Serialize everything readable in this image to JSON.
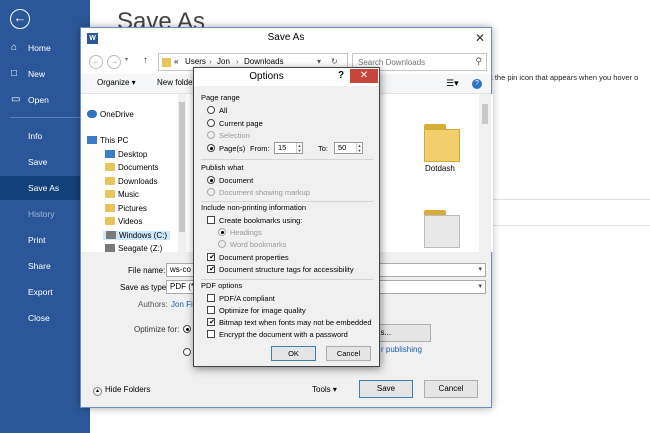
{
  "backstage": {
    "title": "Save As",
    "hint": "k the pin icon that appears when you hover o",
    "nav": [
      {
        "label": "Home",
        "icon": "home-icon"
      },
      {
        "label": "New",
        "icon": "new-document-icon"
      },
      {
        "label": "Open",
        "icon": "open-folder-icon"
      },
      {
        "label": "Info"
      },
      {
        "label": "Save"
      },
      {
        "label": "Save As"
      },
      {
        "label": "History"
      },
      {
        "label": "Print"
      },
      {
        "label": "Share"
      },
      {
        "label": "Export"
      },
      {
        "label": "Close"
      }
    ]
  },
  "save_dialog": {
    "title": "Save As",
    "path": {
      "prefix": "«",
      "parts": [
        "Users",
        "Jon",
        "Downloads"
      ]
    },
    "search_placeholder": "Search Downloads",
    "toolbar": {
      "organize": "Organize ▾",
      "new_folder": "New folder"
    },
    "tree": [
      "OneDrive",
      "This PC",
      "Desktop",
      "Documents",
      "Downloads",
      "Music",
      "Pictures",
      "Videos",
      "Windows (C:)",
      "Seagate (Z:)"
    ],
    "files": [
      {
        "name": "Dotdash"
      }
    ],
    "file_name_label": "File name:",
    "file_name_value": "ws-co",
    "save_type_label": "Save as type:",
    "save_type_value": "PDF (*.",
    "authors_label": "Authors:",
    "authors_value": "Jon Fi",
    "optimize_label": "Optimize for:",
    "options_button_partial": "ns...",
    "publishing_link_partial": "r publishing",
    "hide_folders": "Hide Folders",
    "tools": "Tools",
    "save": "Save",
    "cancel": "Cancel"
  },
  "options_dialog": {
    "title": "Options",
    "help": "?",
    "page_range": {
      "heading": "Page range",
      "all": "All",
      "current": "Current page",
      "selection": "Selection",
      "pages": "Page(s)",
      "from_label": "From:",
      "from": "15",
      "to_label": "To:",
      "to": "50"
    },
    "publish": {
      "heading": "Publish what",
      "document": "Document",
      "markup": "Document showing markup"
    },
    "nonprint": {
      "heading": "Include non-printing information",
      "bookmarks": "Create bookmarks using:",
      "headings": "Headings",
      "word_bookmarks": "Word bookmarks",
      "properties": "Document properties",
      "tags": "Document structure tags for accessibility"
    },
    "pdf": {
      "heading": "PDF options",
      "pdfa": "PDF/A compliant",
      "optimize": "Optimize for image quality",
      "bitmap": "Bitmap text when fonts may not be embedded",
      "encrypt": "Encrypt the document with a password"
    },
    "ok": "OK",
    "cancel": "Cancel"
  }
}
